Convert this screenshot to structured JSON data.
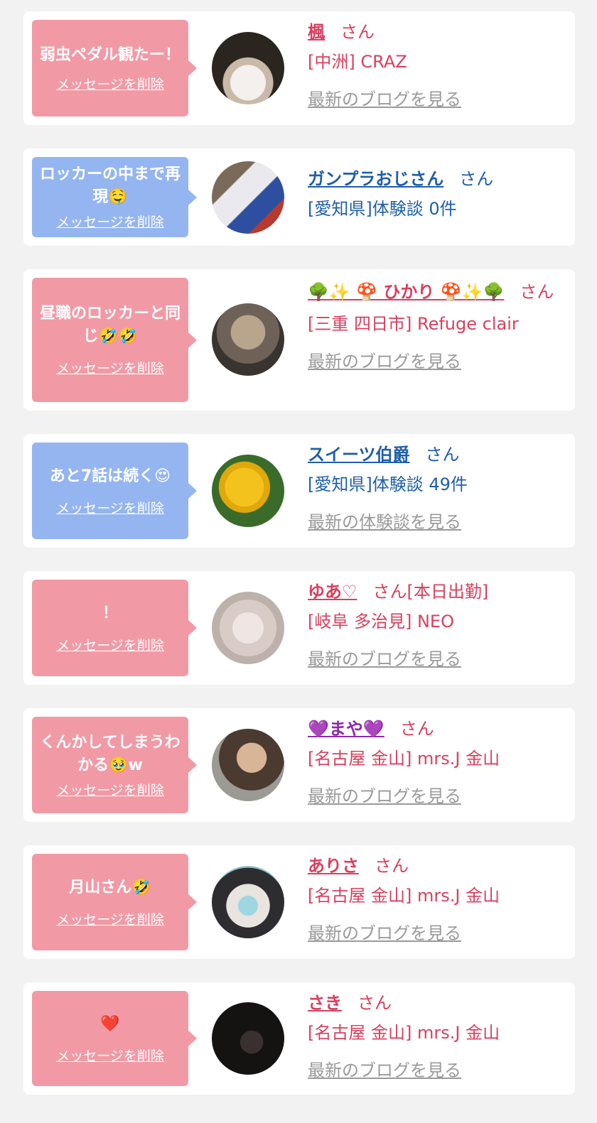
{
  "messages": [
    {
      "bubble_text": "弱虫ペダル観たー！",
      "delete_label": "メッセージを削除",
      "name": "楓",
      "honorific": "さん",
      "shop": "[中洲] CRAZ",
      "latest_link": "最新のブログを見る",
      "style": "pink"
    },
    {
      "bubble_text": "ロッカーの中まで再現🤤",
      "delete_label": "メッセージを削除",
      "name": "ガンプラおじさん",
      "honorific": "さん",
      "shop": "[愛知県]体験談 0件",
      "latest_link": "",
      "style": "blue"
    },
    {
      "bubble_text": "昼職のロッカーと同じ🤣🤣",
      "delete_label": "メッセージを削除",
      "name": "🌳✨ 🍄 ひかり 🍄✨🌳",
      "honorific": "さん",
      "shop": "[三重 四日市] Refuge clair",
      "latest_link": "最新のブログを見る",
      "style": "pink"
    },
    {
      "bubble_text": "あと7話は続く😍",
      "delete_label": "メッセージを削除",
      "name": "スイーツ伯爵",
      "honorific": "さん",
      "shop": "[愛知県]体験談 49件",
      "latest_link": "最新の体験談を見る",
      "style": "blue"
    },
    {
      "bubble_text": "！",
      "delete_label": "メッセージを削除",
      "name": "ゆあ♡",
      "honorific": "さん[本日出勤]",
      "shop": "[岐阜 多治見] NEO",
      "latest_link": "最新のブログを見る",
      "style": "pink"
    },
    {
      "bubble_text": "くんかしてしまうわかる🥹w",
      "delete_label": "メッセージを削除",
      "name": "💜まや💜",
      "honorific": "さん",
      "shop": "[名古屋 金山] mrs.J 金山",
      "latest_link": "最新のブログを見る",
      "style": "pink"
    },
    {
      "bubble_text": "月山さん🤣",
      "delete_label": "メッセージを削除",
      "name": "ありさ",
      "honorific": "さん",
      "shop": "[名古屋 金山] mrs.J 金山",
      "latest_link": "最新のブログを見る",
      "style": "pink"
    },
    {
      "bubble_text": "❤️",
      "delete_label": "メッセージを削除",
      "name": "さき",
      "honorific": "さん",
      "shop": "[名古屋 金山] mrs.J 金山",
      "latest_link": "最新のブログを見る",
      "style": "pink"
    }
  ],
  "colors": {
    "pink_bubble": "#f19aa6",
    "blue_bubble": "#94b5f0",
    "pink_text": "#d8405f",
    "blue_text": "#1f5fa8",
    "gray_link": "#9a9a9a"
  }
}
